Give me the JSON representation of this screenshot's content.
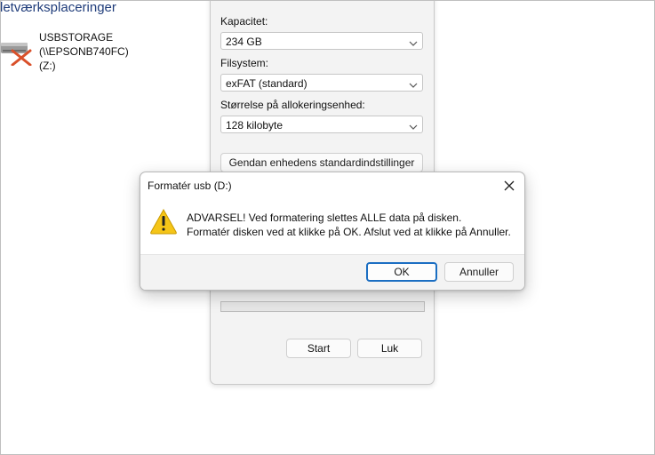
{
  "explorer": {
    "section_header": "letværksplaceringer",
    "drive": {
      "label_line1": "USBSTORAGE (\\\\EPSONB740FC)",
      "label_line2": "(Z:)",
      "icon": "network-drive-disconnected-icon"
    }
  },
  "format_window": {
    "capacity_label": "Kapacitet:",
    "capacity_value": "234 GB",
    "filesystem_label": "Filsystem:",
    "filesystem_value": "exFAT (standard)",
    "allocation_label": "Størrelse på allokeringsenhed:",
    "allocation_value": "128 kilobyte",
    "restore_defaults_label": "Gendan enhedens standardindstillinger",
    "start_label": "Start",
    "close_label": "Luk"
  },
  "dialog": {
    "title": "Formatér usb (D:)",
    "message_line1": "ADVARSEL! Ved formatering slettes ALLE data på disken.",
    "message_line2": "Formatér disken ved at klikke på OK. Afslut ved at klikke på Annuller.",
    "ok_label": "OK",
    "cancel_label": "Annuller",
    "icon": "warning-icon",
    "warning_color": "#f5c518"
  }
}
